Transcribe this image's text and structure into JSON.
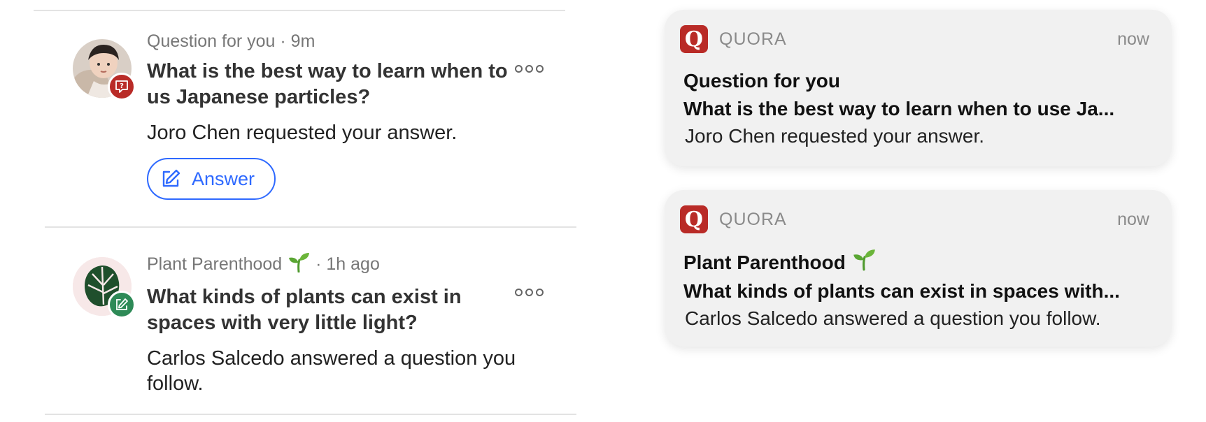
{
  "feed": {
    "items": [
      {
        "meta_source": "Question for you",
        "meta_time": "· 9m",
        "question": "What is the best way to learn when to us Japanese particles?",
        "subtext": "Joro Chen requested your answer.",
        "action_label": "Answer"
      },
      {
        "meta_source": "Plant Parenthood",
        "meta_time": "· 1h ago",
        "question": "What kinds of plants can exist in spaces with very little light?",
        "subtext": "Carlos Salcedo answered a question you follow."
      }
    ]
  },
  "notifications": [
    {
      "app_name": "QUORA",
      "time": "now",
      "title": "Question for you",
      "subtitle": "What is the best way to learn when to use Ja...",
      "body": "Joro Chen requested your answer."
    },
    {
      "app_name": "QUORA",
      "time": "now",
      "title": "Plant Parenthood",
      "subtitle": "What kinds of plants can exist in spaces with...",
      "body": "Carlos Salcedo answered a question you follow."
    }
  ],
  "colors": {
    "brand": "#b92b27",
    "accent_blue": "#2e69ff",
    "answer_badge_green": "#2e8a57"
  },
  "icons": {
    "question_badge": "question-badge-icon",
    "answer_badge": "pencil-badge-icon",
    "leaf": "seedling-icon",
    "more": "more-dots-icon",
    "quora_logo": "quora-logo-icon"
  }
}
